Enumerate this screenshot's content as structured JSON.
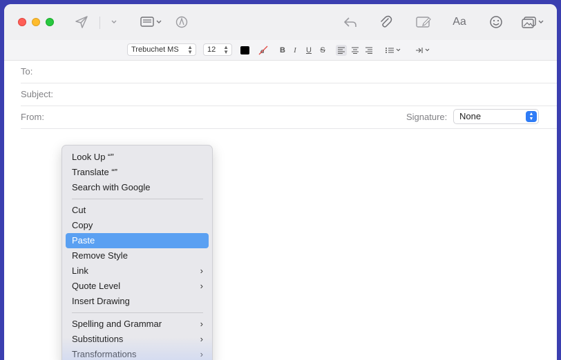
{
  "toolbar": {
    "icons": [
      "send-icon",
      "chevron-down-icon",
      "header-fields-icon",
      "markup-icon",
      "reply-icon",
      "paperclip-icon",
      "compose-icon",
      "font-icon",
      "emoji-icon",
      "photo-icon"
    ],
    "font_button_label": "Aa"
  },
  "format_bar": {
    "font_family": "Trebuchet MS",
    "font_size": "12",
    "text_color": "#000000",
    "bold": "B",
    "italic": "I",
    "underline": "U",
    "strikethrough": "S"
  },
  "fields": {
    "to_label": "To:",
    "subject_label": "Subject:",
    "from_label": "From:",
    "signature_label": "Signature:",
    "signature_value": "None"
  },
  "context_menu": {
    "items": [
      {
        "label": "Look Up “”"
      },
      {
        "label": "Translate “”"
      },
      {
        "label": "Search with Google"
      },
      {
        "label": "Cut"
      },
      {
        "label": "Copy"
      },
      {
        "label": "Paste",
        "selected": true
      },
      {
        "label": "Remove Style"
      },
      {
        "label": "Link",
        "submenu": true
      },
      {
        "label": "Quote Level",
        "submenu": true
      },
      {
        "label": "Insert Drawing"
      },
      {
        "label": "Spelling and Grammar",
        "submenu": true
      },
      {
        "label": "Substitutions",
        "submenu": true
      },
      {
        "label": "Transformations",
        "submenu": true
      }
    ],
    "submenu_glyph": "›"
  },
  "colors": {
    "accent": "#2f7cf6",
    "menu_selection": "#5aa0f2",
    "desktop": "#3b3fb0"
  }
}
